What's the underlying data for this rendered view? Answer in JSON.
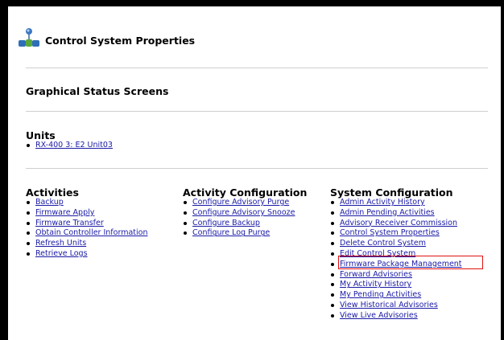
{
  "page": {
    "title": "Control System Properties",
    "graphical_status_heading": "Graphical Status Screens"
  },
  "units": {
    "heading": "Units",
    "items": [
      "RX-400 3: E2 Unit03"
    ]
  },
  "activities": {
    "heading": "Activities",
    "items": [
      "Backup",
      "Firmware Apply",
      "Firmware Transfer",
      "Obtain Controller Information",
      "Refresh Units",
      "Retrieve Logs"
    ]
  },
  "activity_configuration": {
    "heading": "Activity Configuration",
    "items": [
      "Configure Advisory Purge",
      "Configure Advisory Snooze",
      "Configure Backup",
      "Configure Log Purge"
    ]
  },
  "system_configuration": {
    "heading": "System Configuration",
    "items": [
      "Admin Activity History",
      "Admin Pending Activities",
      "Advisory Receiver Commission",
      "Control System Properties",
      "Delete Control System",
      "Edit Control System",
      "Firmware Package Management",
      "Forward Advisories",
      "My Activity History",
      "My Pending Activities",
      "View Historical Advisories",
      "View Live Advisories"
    ]
  },
  "icons": {
    "header_icon": "network-nodes-icon"
  },
  "colors": {
    "link": "#1a1aa6",
    "highlight": "#e01010"
  }
}
